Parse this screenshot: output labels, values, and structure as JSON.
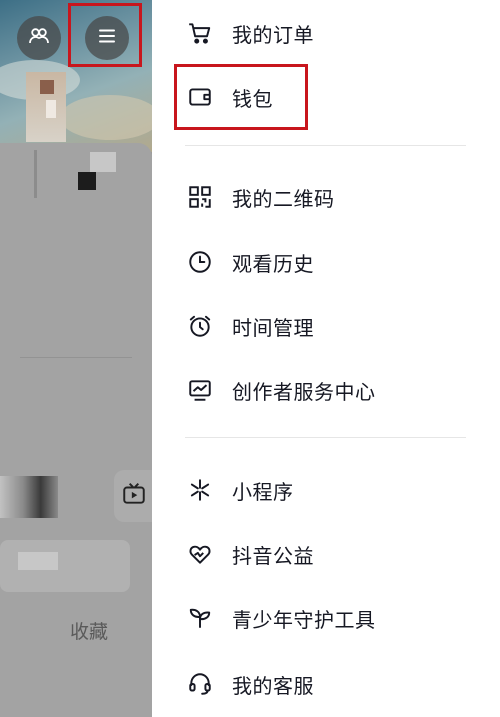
{
  "profile": {
    "collect_label": "收藏"
  },
  "icons": {
    "friends": "friends-icon",
    "menu": "hamburger-menu-icon",
    "tv": "tv-icon"
  },
  "colors": {
    "highlight": "#c8161d",
    "overlay": "#9a9a9a",
    "text": "#161823"
  },
  "menu": {
    "group1": [
      {
        "label": "我的订单",
        "icon": "shopping-cart-icon"
      },
      {
        "label": "钱包",
        "icon": "wallet-icon"
      }
    ],
    "group2": [
      {
        "label": "我的二维码",
        "icon": "qr-code-icon"
      },
      {
        "label": "观看历史",
        "icon": "clock-icon"
      },
      {
        "label": "时间管理",
        "icon": "alarm-clock-icon"
      },
      {
        "label": "创作者服务中心",
        "icon": "creator-chart-icon"
      }
    ],
    "group3": [
      {
        "label": "小程序",
        "icon": "mini-program-icon"
      },
      {
        "label": "抖音公益",
        "icon": "charity-heart-icon"
      },
      {
        "label": "青少年守护工具",
        "icon": "sprout-icon"
      },
      {
        "label": "我的客服",
        "icon": "headset-icon"
      }
    ]
  }
}
